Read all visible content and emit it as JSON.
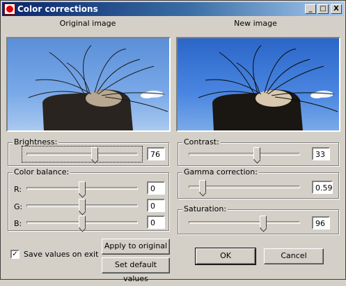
{
  "window": {
    "title": "Color corrections",
    "controls": {
      "minimize": "_",
      "maximize": "□",
      "close": "X"
    }
  },
  "previews": {
    "original_caption": "Original image",
    "new_caption": "New image"
  },
  "brightness": {
    "label": "Brightness:",
    "value": "76",
    "level": 0.62
  },
  "contrast": {
    "label": "Contrast:",
    "value": "33",
    "level": 0.62
  },
  "color_balance": {
    "label": "Color balance:",
    "channels": [
      {
        "label": "R:",
        "value": "0",
        "level": 0.5
      },
      {
        "label": "G:",
        "value": "0",
        "level": 0.5
      },
      {
        "label": "B:",
        "value": "0",
        "level": 0.5
      }
    ]
  },
  "gamma": {
    "label": "Gamma correction:",
    "value": "0.59",
    "level": 0.1
  },
  "saturation": {
    "label": "Saturation:",
    "value": "96",
    "level": 0.68
  },
  "options": {
    "save_values_label": "Save values on exit",
    "save_values_checked": true
  },
  "buttons": {
    "apply_to_original": "Apply to original",
    "set_default_values": "Set default values",
    "ok": "OK",
    "cancel": "Cancel"
  }
}
